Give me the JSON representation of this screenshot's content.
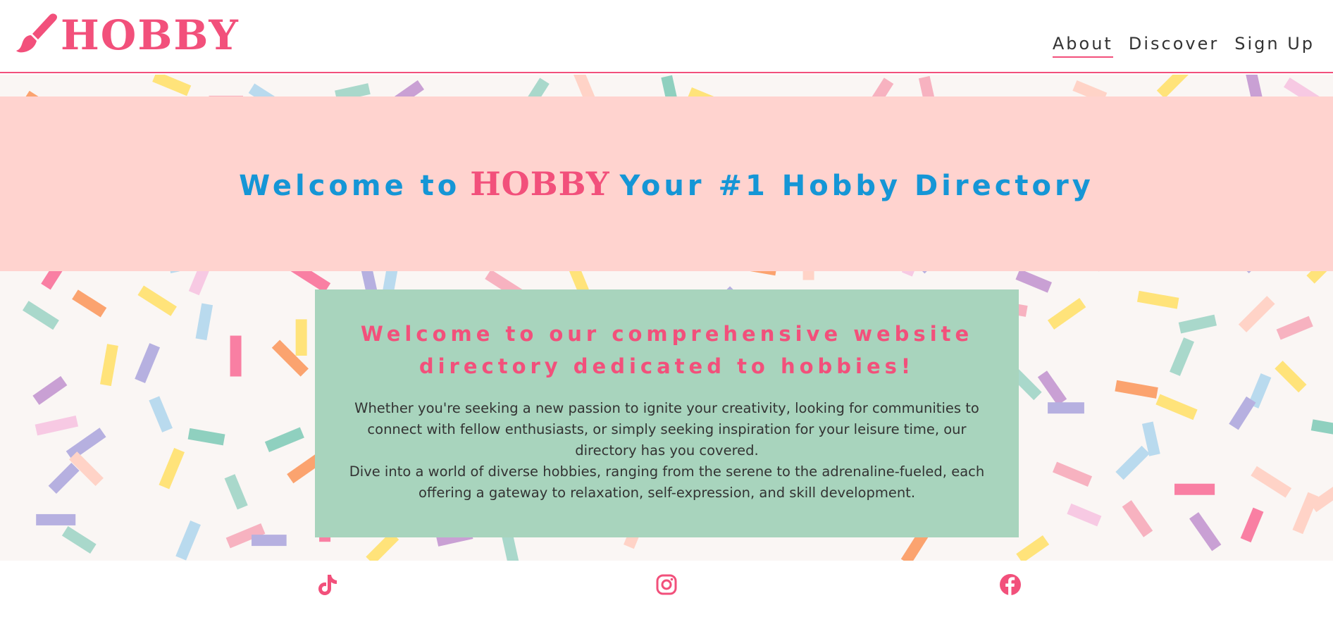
{
  "brand": {
    "logo_text": "HOBBY",
    "icon": "paintbrush-icon"
  },
  "nav": [
    {
      "label": "About",
      "active": true
    },
    {
      "label": "Discover",
      "active": false
    },
    {
      "label": "Sign Up",
      "active": false
    }
  ],
  "hero": {
    "prefix": "Welcome to",
    "brand": "HOBBY",
    "suffix": "Your #1 Hobby Directory"
  },
  "card": {
    "heading": "Welcome to our comprehensive website directory dedicated to hobbies!",
    "paragraph1": "Whether you're seeking a new passion to ignite your creativity, looking for communities to connect with fellow enthusiasts, or simply seeking inspiration for your leisure time, our directory has you covered.",
    "paragraph2": "Dive into a world of diverse hobbies, ranging from the serene to the adrenaline-fueled, each offering a gateway to relaxation, self-expression, and skill development."
  },
  "footer": {
    "social": [
      {
        "icon": "tiktok-icon"
      },
      {
        "icon": "instagram-icon"
      },
      {
        "icon": "facebook-icon"
      }
    ]
  },
  "colors": {
    "accent_pink": "#f2507b",
    "hero_bg": "#ffd3cf",
    "hero_text": "#1596d6",
    "card_bg": "#a8d4bd",
    "page_bg": "#faf6f4"
  }
}
